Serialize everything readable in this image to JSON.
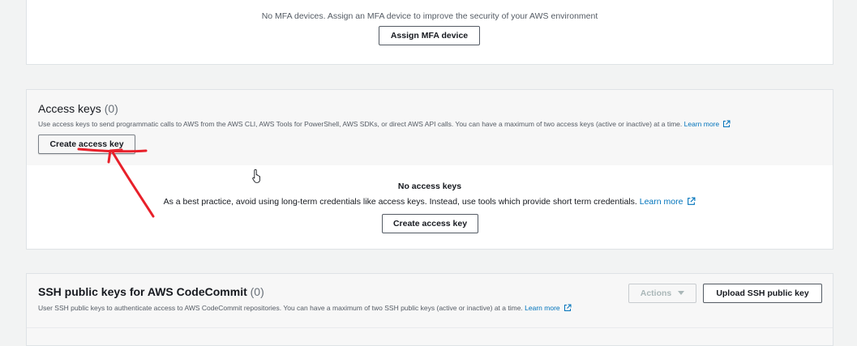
{
  "mfa": {
    "message": "No MFA devices. Assign an MFA device to improve the security of your AWS environment",
    "assign_button": "Assign MFA device"
  },
  "access_keys": {
    "title": "Access keys",
    "count": "(0)",
    "description": "Use access keys to send programmatic calls to AWS from the AWS CLI, AWS Tools for PowerShell, AWS SDKs, or direct AWS API calls. You can have a maximum of two access keys (active or inactive) at a time.",
    "learn_more": "Learn more",
    "create_button": "Create access key",
    "empty_title": "No access keys",
    "empty_description": "As a best practice, avoid using long-term credentials like access keys. Instead, use tools which provide short term credentials.",
    "empty_learn_more": "Learn more",
    "empty_create_button": "Create access key"
  },
  "ssh": {
    "title": "SSH public keys for AWS CodeCommit",
    "count": "(0)",
    "description": "User SSH public keys to authenticate access to AWS CodeCommit repositories. You can have a maximum of two SSH public keys (active or inactive) at a time.",
    "learn_more": "Learn more",
    "actions_button": "Actions",
    "upload_button": "Upload SSH public key"
  },
  "colors": {
    "link": "#0073bb",
    "annotation": "#e8202a",
    "panel_header": "#f7f7f7",
    "page_background": "#f2f3f3"
  },
  "icons": [
    "external-link-icon",
    "caret-down-icon",
    "hand-pointer-cursor-icon"
  ]
}
